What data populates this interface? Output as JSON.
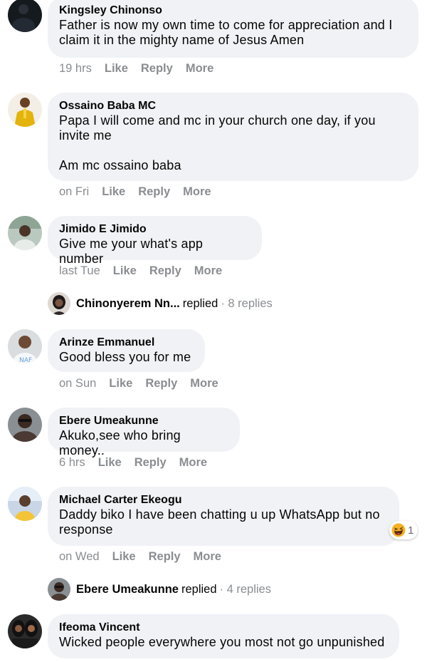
{
  "comments": [
    {
      "name": "Kingsley Chinonso",
      "lines": [
        "Father is now my own time to come for appreciation and I",
        "claim it in the mighty name of Jesus Amen"
      ],
      "time": "19 hrs",
      "like": "Like",
      "reply": "Reply",
      "more": "More"
    },
    {
      "name": "Ossaino Baba MC",
      "lines": [
        "Papa I will come and mc in your church one day, if you",
        "invite me",
        "",
        "Am mc ossaino baba"
      ],
      "time": "on Fri",
      "like": "Like",
      "reply": "Reply",
      "more": "More"
    },
    {
      "name": "Jimido E Jimido",
      "lines": [
        "Give me your what's app number"
      ],
      "time": "last Tue",
      "like": "Like",
      "reply": "Reply",
      "more": "More"
    },
    {
      "name": "Arinze Emmanuel",
      "lines": [
        "Good bless you for me"
      ],
      "time": "on Sun",
      "like": "Like",
      "reply": "Reply",
      "more": "More"
    },
    {
      "name": "Ebere Umeakunne",
      "lines": [
        "Akuko,see who bring money.."
      ],
      "time": "6 hrs",
      "like": "Like",
      "reply": "Reply",
      "more": "More"
    },
    {
      "name": "Michael Carter Ekeogu",
      "lines": [
        "Daddy biko I have been chatting u up WhatsApp but no",
        "response"
      ],
      "time": "on Wed",
      "like": "Like",
      "reply": "Reply",
      "more": "More"
    },
    {
      "name": "Ifeoma Vincent",
      "lines": [
        "Wicked people everywhere you most not go unpunished"
      ]
    }
  ],
  "reply_threads": [
    {
      "name": "Chinonyerem Nn...",
      "action": "replied",
      "count": "· 8 replies"
    },
    {
      "name": "Ebere Umeakunne",
      "action": "replied",
      "count": "· 4 replies"
    }
  ],
  "reaction": {
    "icon": "laughing-emoji-icon",
    "count": "1"
  },
  "colors": {
    "bubble": "#f0f2f5",
    "meta": "#8a8d91",
    "text": "#050505"
  }
}
